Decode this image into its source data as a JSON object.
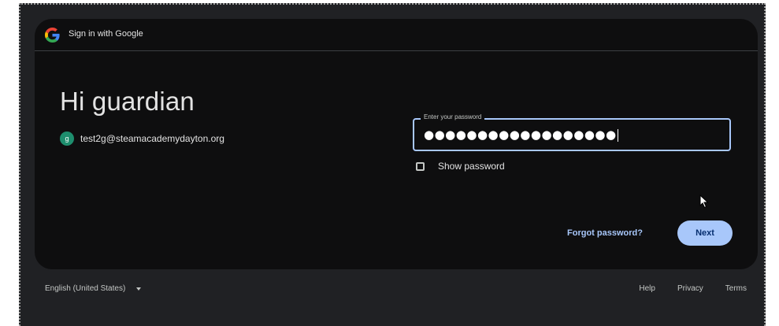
{
  "header": {
    "title": "Sign in with Google",
    "logo_icon": "google-g-icon"
  },
  "main": {
    "greeting": "Hi guardian",
    "account": {
      "avatar_letter": "g",
      "email": "test2g@steamacademydayton.org"
    },
    "password": {
      "label": "Enter your password",
      "masked_value": "●●●●●●●●●●●●●●●●●●"
    },
    "show_password": {
      "label": "Show password",
      "checked": false
    },
    "forgot_label": "Forgot password?",
    "next_label": "Next"
  },
  "footer": {
    "language": "English (United States)",
    "links": {
      "help": "Help",
      "privacy": "Privacy",
      "terms": "Terms"
    }
  },
  "colors": {
    "page_bg": "#202124",
    "card_bg": "#0e0e0f",
    "accent": "#a8c7fa",
    "avatar": "#1e8e6e"
  }
}
